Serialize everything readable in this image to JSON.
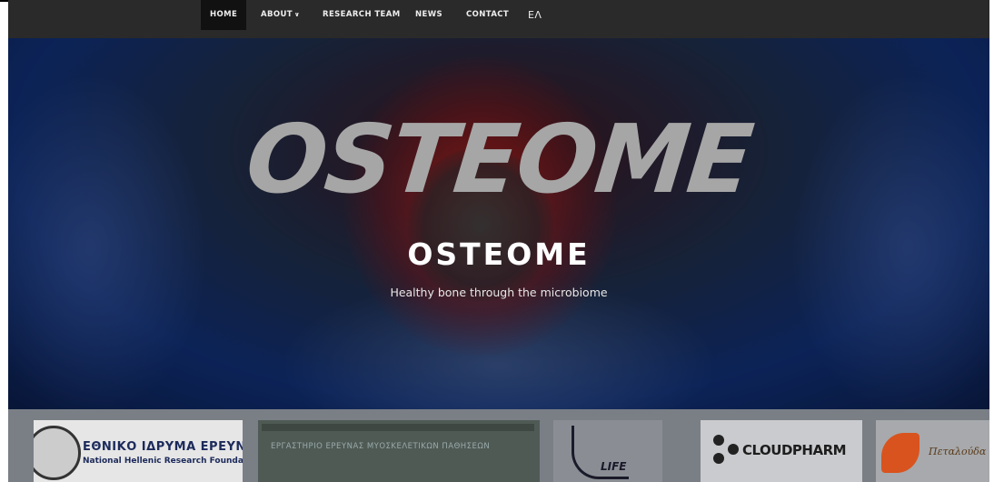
{
  "nav": {
    "items": [
      {
        "label": "HOME",
        "active": true
      },
      {
        "label": "ABOUT",
        "has_dropdown": true
      },
      {
        "label": "RESEARCH TEAM"
      },
      {
        "label": "NEWS"
      },
      {
        "label": "CONTACT"
      },
      {
        "label": "ΕΛ"
      }
    ]
  },
  "hero": {
    "banner_word": "OSTEOME",
    "site_title": "OSTEOME",
    "tagline": "Healthy bone through the microbiome"
  },
  "partners": {
    "nhrf": {
      "name_gr": "ΕΘΝΙΚΟ ΙΔΡΥΜΑ ΕΡΕΥΝΩΝ",
      "name_en": "National Hellenic Research Foundation"
    },
    "lab": {
      "text": "ΕΡΓΑΣΤΗΡΙΟ ΕΡΕΥΝΑΣ ΜΥΟΣΚΕΛΕΤΙΚΩΝ ΠΑΘΗΣΕΩΝ"
    },
    "life": {
      "text": "LIFE"
    },
    "cloudpharm": {
      "text": "CLOUDPHARM"
    },
    "petaloude": {
      "text": "Πεταλούδα"
    }
  },
  "colors": {
    "nav_bg": "#2a2a2a",
    "active_bg": "#111111",
    "hero_text": "#ffffff",
    "partners_bg": "#7a7f86"
  }
}
